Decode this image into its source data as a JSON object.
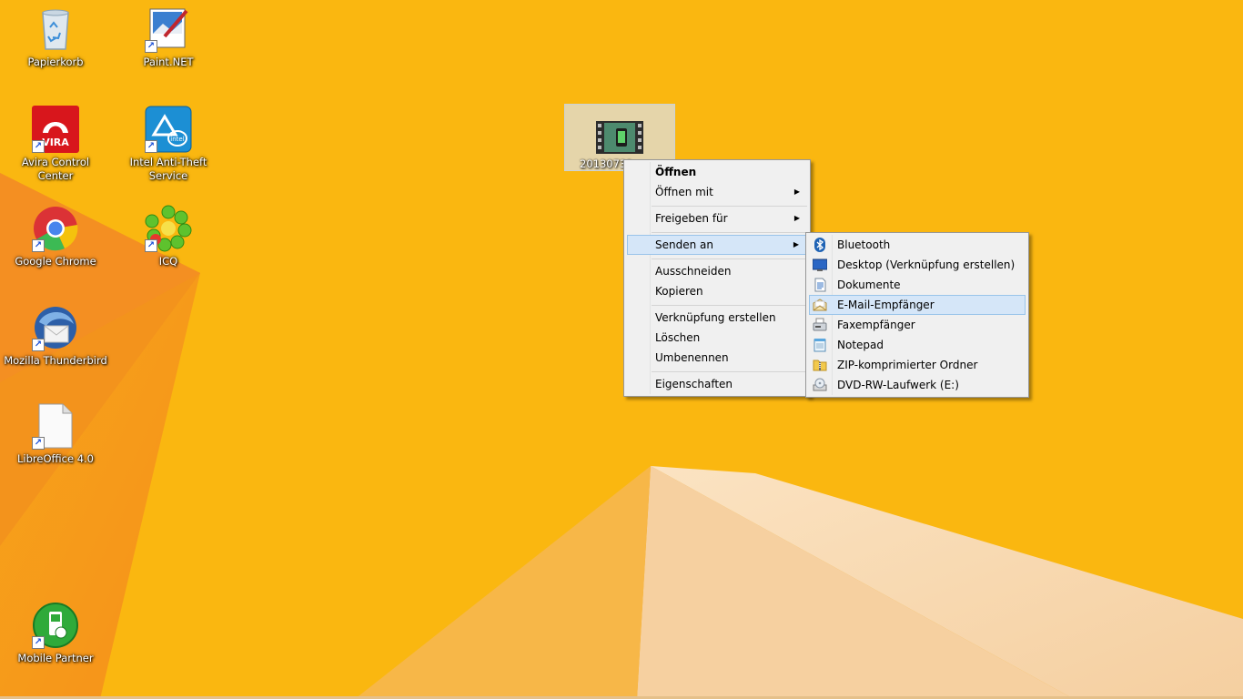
{
  "desktop": {
    "icons": [
      {
        "label": "Papierkorb",
        "icon": "recycle-bin-icon"
      },
      {
        "label": "Paint.NET",
        "icon": "paint-net-icon"
      },
      {
        "label": "Avira Control Center",
        "icon": "avira-icon"
      },
      {
        "label": "Intel Anti-Theft Service",
        "icon": "intel-anti-theft-icon"
      },
      {
        "label": "Google Chrome",
        "icon": "chrome-icon"
      },
      {
        "label": "ICQ",
        "icon": "icq-flower-icon"
      },
      {
        "label": "Mozilla Thunderbird",
        "icon": "thunderbird-icon"
      },
      {
        "label": "LibreOffice 4.0",
        "icon": "libreoffice-icon"
      },
      {
        "label": "Mobile Partner",
        "icon": "mobile-partner-icon"
      }
    ],
    "selected_file": {
      "label": "20130731_",
      "icon": "video-file-icon"
    }
  },
  "context_menu": {
    "items": [
      {
        "label": "Öffnen"
      },
      {
        "label": "Öffnen mit"
      },
      {
        "label": "Freigeben für"
      },
      {
        "label": "Senden an"
      },
      {
        "label": "Ausschneiden"
      },
      {
        "label": "Kopieren"
      },
      {
        "label": "Verknüpfung erstellen"
      },
      {
        "label": "Löschen"
      },
      {
        "label": "Umbenennen"
      },
      {
        "label": "Eigenschaften"
      }
    ],
    "highlighted": "Senden an"
  },
  "sendto_menu": {
    "items": [
      {
        "label": "Bluetooth",
        "icon": "bluetooth-icon"
      },
      {
        "label": "Desktop (Verknüpfung erstellen)",
        "icon": "desktop-icon"
      },
      {
        "label": "Dokumente",
        "icon": "documents-icon"
      },
      {
        "label": "E-Mail-Empfänger",
        "icon": "mail-recipient-icon"
      },
      {
        "label": "Faxempfänger",
        "icon": "fax-icon"
      },
      {
        "label": "Notepad",
        "icon": "notepad-icon"
      },
      {
        "label": "ZIP-komprimierter Ordner",
        "icon": "zip-folder-icon"
      },
      {
        "label": "DVD-RW-Laufwerk (E:)",
        "icon": "dvd-drive-icon"
      }
    ],
    "highlighted": "E-Mail-Empfänger"
  },
  "colors": {
    "wallpaper": "#f9b10c",
    "menu_bg": "#f0f0f0",
    "highlight_bg": "#d5e6f8",
    "highlight_border": "#99c4ea"
  }
}
